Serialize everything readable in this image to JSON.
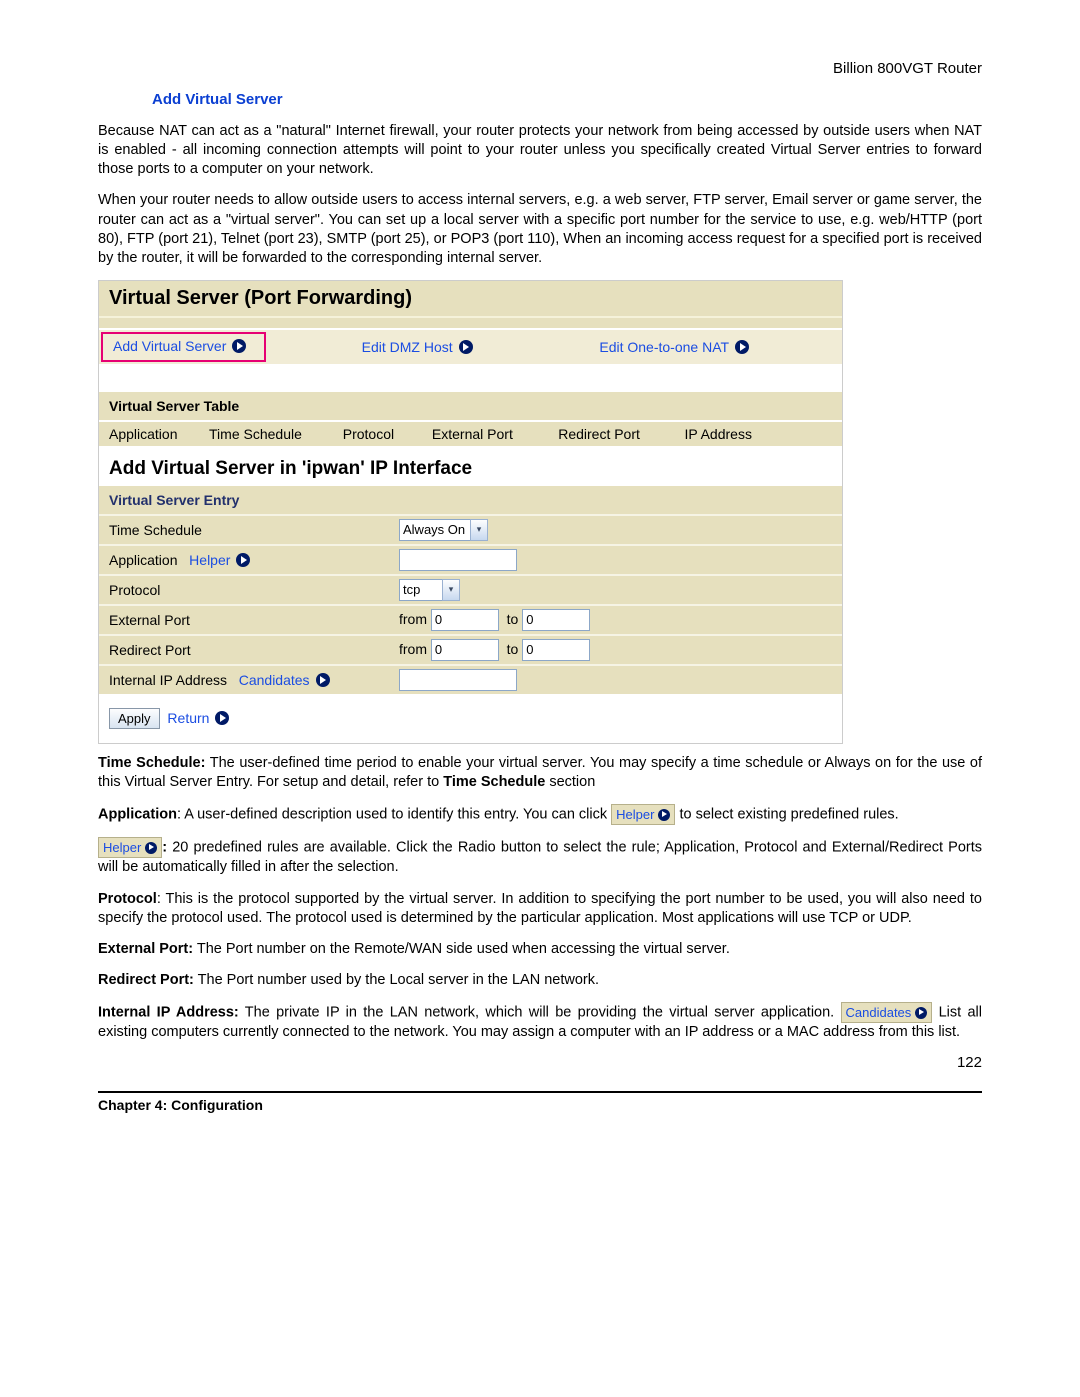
{
  "header": {
    "router": "Billion 800VGT Router"
  },
  "title": "Add Virtual Server",
  "paragraphs": {
    "p1": "Because NAT can act as a \"natural\" Internet firewall, your router protects your network from being accessed by outside users when NAT is enabled - all incoming connection attempts will point to your router unless you specifically created Virtual Server entries to forward those ports to a computer on your network.",
    "p2": "When your router needs to allow outside users to access internal servers, e.g. a web server, FTP server, Email server or game server, the router can act as a \"virtual server\". You can set up a local server with a specific port number for the service to use, e.g. web/HTTP (port 80), FTP (port 21), Telnet (port 23), SMTP (port 25), or POP3 (port 110), When an incoming access request for a specified port is received by the router, it will be forwarded to the corresponding internal server."
  },
  "ss": {
    "panel_title": "Virtual Server (Port Forwarding)",
    "menu": {
      "add": "Add Virtual Server",
      "dmz": "Edit DMZ Host",
      "nat": "Edit One-to-one NAT"
    },
    "table_title": "Virtual Server Table",
    "cols": {
      "app": "Application",
      "ts": "Time Schedule",
      "proto": "Protocol",
      "ext": "External Port",
      "redir": "Redirect Port",
      "ip": "IP Address"
    },
    "add_title": "Add Virtual Server in 'ipwan' IP Interface",
    "entry_title": "Virtual Server Entry",
    "labels": {
      "ts": "Time Schedule",
      "app": "Application",
      "helper": "Helper",
      "proto": "Protocol",
      "ext": "External Port",
      "redir": "Redirect Port",
      "intip": "Internal IP Address",
      "cand": "Candidates",
      "from": "from",
      "to": "to"
    },
    "values": {
      "ts_select": "Always On",
      "proto_select": "tcp",
      "ext_from": "0",
      "ext_to": "0",
      "redir_from": "0",
      "redir_to": "0"
    },
    "buttons": {
      "apply": "Apply",
      "return": "Return"
    }
  },
  "defs": {
    "ts_label": "Time Schedule:",
    "ts_text": " The user-defined time period to enable your virtual server.  You may specify a time schedule or Always on for the use of this Virtual Server Entry.  For setup and detail, refer to ",
    "ts_bold2": "Time Schedule",
    "ts_tail": " section",
    "app_label": "Application",
    "app_text1": ": A user-defined description used to identify this entry. You can click ",
    "app_chip": "Helper",
    "app_text2": " to select existing predefined rules.",
    "helper_label": "Helper",
    "helper_colon": ":",
    "helper_text": " 20 predefined rules are available.  Click the Radio button to select the rule; Application, Protocol and External/Redirect Ports will be automatically filled in after the selection.",
    "proto_label": "Protocol",
    "proto_text": ": This is the protocol supported by the virtual server. In addition to specifying the port number to be used, you will also need to specify the protocol used. The protocol used is determined by the particular application. Most applications will use TCP or UDP.",
    "ext_label": "External Port:",
    "ext_text": " The Port number on the Remote/WAN side used when accessing the virtual server.",
    "redir_label": "Redirect Port:",
    "redir_text": " The Port number used by the Local server in the LAN network.",
    "intip_label": "Internal IP Address:",
    "intip_text1": " The private IP in the LAN network, which will be providing the virtual server application.  ",
    "intip_chip": "Candidates",
    "intip_text2": " List all existing computers currently connected to the network. You may assign a computer with an IP address or a MAC address from this list."
  },
  "footer": {
    "page": "122",
    "chapter": "Chapter 4: Configuration"
  }
}
